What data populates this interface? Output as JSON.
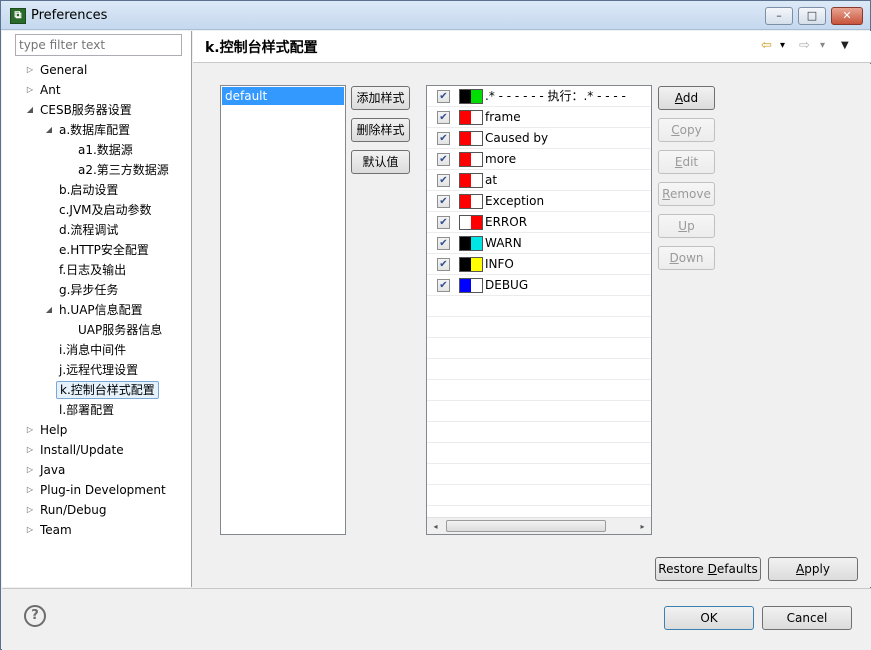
{
  "window": {
    "title": "Preferences",
    "app_icon_text": "⧉"
  },
  "window_buttons": {
    "min": "–",
    "max": "□",
    "close": "✕"
  },
  "filter": {
    "placeholder": "type filter text"
  },
  "tree": [
    {
      "label": "General",
      "twisty": "▷"
    },
    {
      "label": "Ant",
      "twisty": "▷"
    },
    {
      "label": "CESB服务器设置",
      "twisty": "◢"
    },
    {
      "label": "a.数据库配置",
      "twisty": "◢"
    },
    {
      "label": "a1.数据源",
      "twisty": ""
    },
    {
      "label": "a2.第三方数据源",
      "twisty": ""
    },
    {
      "label": "b.启动设置",
      "twisty": ""
    },
    {
      "label": "c.JVM及启动参数",
      "twisty": ""
    },
    {
      "label": "d.流程调试",
      "twisty": ""
    },
    {
      "label": "e.HTTP安全配置",
      "twisty": ""
    },
    {
      "label": "f.日志及输出",
      "twisty": ""
    },
    {
      "label": "g.异步任务",
      "twisty": ""
    },
    {
      "label": "h.UAP信息配置",
      "twisty": "◢"
    },
    {
      "label": "UAP服务器信息",
      "twisty": ""
    },
    {
      "label": "i.消息中间件",
      "twisty": ""
    },
    {
      "label": "j.远程代理设置",
      "twisty": ""
    },
    {
      "label": "k.控制台样式配置",
      "twisty": "",
      "selected": true
    },
    {
      "label": "l.部署配置",
      "twisty": ""
    },
    {
      "label": "Help",
      "twisty": "▷"
    },
    {
      "label": "Install/Update",
      "twisty": "▷"
    },
    {
      "label": "Java",
      "twisty": "▷"
    },
    {
      "label": "Plug-in Development",
      "twisty": "▷"
    },
    {
      "label": "Run/Debug",
      "twisty": "▷"
    },
    {
      "label": "Team",
      "twisty": "▷"
    }
  ],
  "header": {
    "title": "k.控制台样式配置",
    "back_icon": "⇦",
    "forward_icon": "⇨",
    "dropdown_icon": "▾",
    "menu_icon": "▼"
  },
  "styles": {
    "items": [
      "default"
    ]
  },
  "style_buttons": {
    "add": "添加样式",
    "delete": "删除样式",
    "default": "默认值"
  },
  "rules": [
    {
      "text": ".* - - - - - - 执行：.* - - - -",
      "checked": true,
      "fg": "#000000",
      "bg": "#00dd00"
    },
    {
      "text": "frame",
      "checked": true,
      "fg": "#ff0000",
      "bg": "#ffffff"
    },
    {
      "text": "Caused by",
      "checked": true,
      "fg": "#ff0000",
      "bg": "#ffffff"
    },
    {
      "text": "more",
      "checked": true,
      "fg": "#ff0000",
      "bg": "#ffffff"
    },
    {
      "text": "at",
      "checked": true,
      "fg": "#ff0000",
      "bg": "#ffffff"
    },
    {
      "text": "Exception",
      "checked": true,
      "fg": "#ff0000",
      "bg": "#ffffff"
    },
    {
      "text": "ERROR",
      "checked": true,
      "fg": "#ffffff",
      "bg": "#ff0000"
    },
    {
      "text": "WARN",
      "checked": true,
      "fg": "#000000",
      "bg": "#00e5e5"
    },
    {
      "text": "INFO",
      "checked": true,
      "fg": "#000000",
      "bg": "#ffff00"
    },
    {
      "text": "DEBUG",
      "checked": true,
      "fg": "#0000ff",
      "bg": "#ffffff"
    }
  ],
  "check_glyph": "✔",
  "scroll": {
    "left": "◂",
    "right": "▸"
  },
  "rule_buttons": {
    "add": {
      "pre": "",
      "u": "A",
      "post": "dd"
    },
    "copy": {
      "pre": "",
      "u": "C",
      "post": "opy"
    },
    "edit": {
      "pre": "",
      "u": "E",
      "post": "dit"
    },
    "remove": {
      "pre": "",
      "u": "R",
      "post": "emove"
    },
    "up": {
      "pre": "",
      "u": "U",
      "post": "p"
    },
    "down": {
      "pre": "",
      "u": "D",
      "post": "own"
    }
  },
  "actions": {
    "restore": {
      "pre": "Restore ",
      "u": "D",
      "post": "efaults"
    },
    "apply": {
      "pre": "",
      "u": "A",
      "post": "pply"
    }
  },
  "footer": {
    "help": "?",
    "ok": "OK",
    "cancel": "Cancel"
  }
}
